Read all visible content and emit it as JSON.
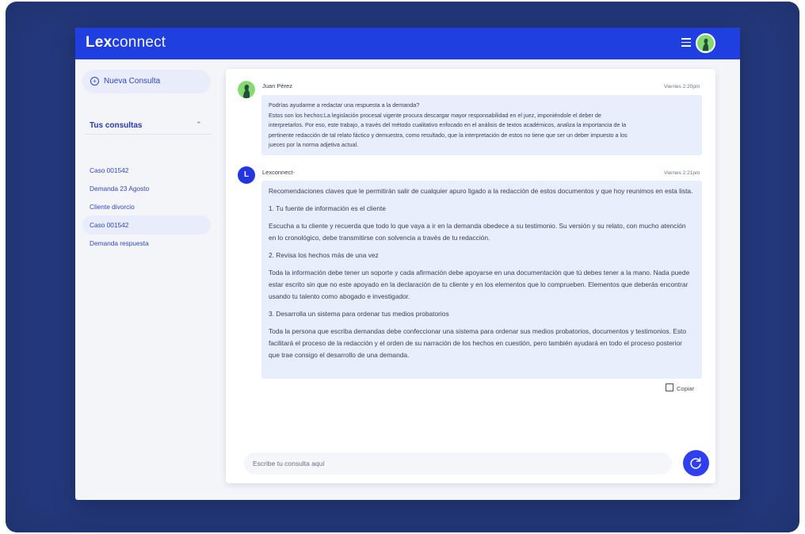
{
  "app": {
    "logo_bold": "Lex",
    "logo_light": "connect"
  },
  "sidebar": {
    "new_button": "Nueva Consulta",
    "section_title": "Tus consultas",
    "items": [
      {
        "label": "Caso 001542"
      },
      {
        "label": "Demanda 23 Agosto"
      },
      {
        "label": "Cliente divorcio"
      },
      {
        "label": "Caso 001542"
      },
      {
        "label": "Demanda respuesta"
      }
    ]
  },
  "chat": {
    "user_message": {
      "name": "Juan Pérez",
      "time": "Viernes 2:20pm",
      "lines": [
        "Podrías ayudarme a redactar una respuesta a la demanda?",
        "Estos son los hechos:La legislación procesal vigente procura descargar mayor responsabilidad en el juez, imponiéndole el deber de",
        "interpretarlos. Por eso, este trabajo, a través del método cualitativo enfocado en el análisis de textos académicos, analiza la importancia de la",
        "pertinente redacción de tal relato fáctico y demuestra, como resultado, que la interpretación de estos no tiene que ser un deber impuesto a los",
        "jueces por la norma adjetiva actual."
      ]
    },
    "bot_message": {
      "avatar_letter": "L",
      "name": "Lexconnect-",
      "time": "Viernes 2:21pm",
      "paragraphs": [
        "Recomendaciones claves que le permitirán salir de cualquier apuro ligado a la redacción de estos documentos y que hoy reunimos en esta lista.",
        "1. Tu fuente de información es el cliente",
        "Escucha a tu cliente y recuerda que todo lo que vaya a ir en la demanda obedece a su testimonio. Su versión y su relato, con mucho atención en lo cronológico, debe transmitirse con solvencia a través de tu redacción.",
        "2. Revisa los hechos más de una vez",
        "Toda la información debe tener un soporte y cada afirmación debe apoyarse en una documentación que tú debes tener a la mano. Nada puede estar escrito sin que no este apoyado en la declaración de tu cliente y en los elementos que lo comprueben. Elementos que deberás encontrar usando tu talento como abogado e investigador.",
        "3. Desarrolla un sistema para ordenar tus medios probatorios",
        "Toda la persona que escriba demandas debe confeccionar una sistema para ordenar sus medios probatorios, documentos y testimonios. Esto facilitará el proceso de la redacción y el orden de su narración de los hechos en cuestión, pero también ayudará en todo el proceso posterior que trae consigo el desarrollo de una demanda."
      ],
      "copy_label": "Copiar"
    },
    "input_placeholder": "Escribe tu consulta aquí"
  },
  "colors": {
    "brand": "#1f3fe0",
    "frame": "#24397d",
    "bubble": "#e9eefc",
    "send": "#2f3ff0"
  },
  "icons": {
    "menu": "hamburger-icon",
    "new": "plus-circle-icon",
    "chevron": "chevron-up-icon",
    "copy": "copy-icon",
    "send": "refresh-send-icon"
  }
}
